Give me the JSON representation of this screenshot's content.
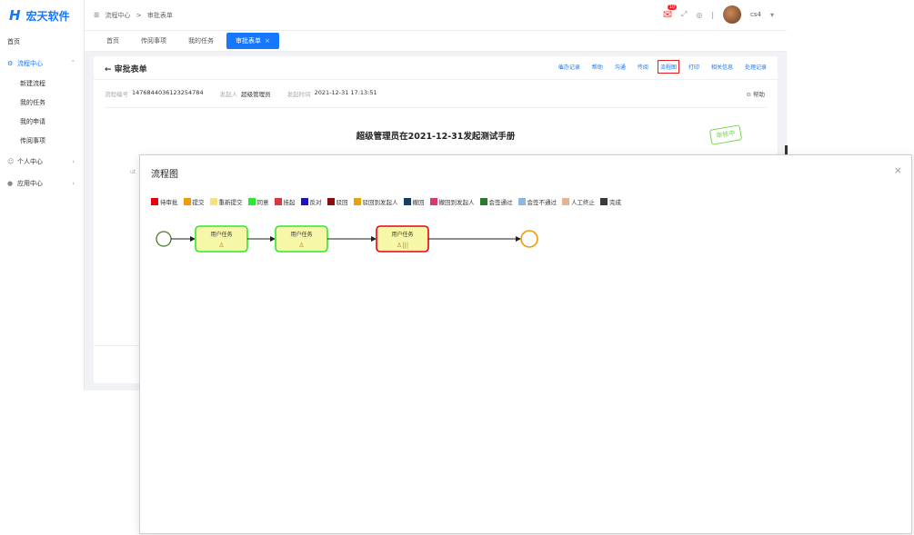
{
  "logo": {
    "text": "宏天软件"
  },
  "sidebar": {
    "items": [
      {
        "label": "首页"
      },
      {
        "label": "流程中心"
      },
      {
        "label": "新建流程"
      },
      {
        "label": "我的任务"
      },
      {
        "label": "我的申请"
      },
      {
        "label": "传阅事项"
      },
      {
        "label": "个人中心"
      },
      {
        "label": "应用中心"
      }
    ]
  },
  "breadcrumb": {
    "root": "流程中心",
    "sep": ">",
    "current": "审批表单"
  },
  "header": {
    "notification_count": "10",
    "username": "cs4"
  },
  "tabs": [
    {
      "label": "首页"
    },
    {
      "label": "传阅事项"
    },
    {
      "label": "我的任务"
    },
    {
      "label": "审批表单",
      "close": "×"
    }
  ],
  "card": {
    "back_label": "← 审批表单",
    "actions": [
      "催办记录",
      "帮助",
      "沟通",
      "传阅",
      "流程图",
      "打印",
      "相关信息",
      "处理记录"
    ],
    "meta": {
      "flow_no_label": "流程编号",
      "flow_no": "1476844036123254784",
      "initiator_label": "发起人",
      "initiator": "超级管理员",
      "time_label": "发起时间",
      "time": "2021-12-31 17:13:51"
    },
    "help_label": "帮助",
    "doc_title": "超级管理员在2021-12-31发起测试手册",
    "stamp": "审核中"
  },
  "modal": {
    "title": "流程图",
    "close": "×",
    "legend": [
      {
        "label": "待审批",
        "color": "#e60012"
      },
      {
        "label": "提交",
        "color": "#f29b05"
      },
      {
        "label": "重新提交",
        "color": "#f7e17a"
      },
      {
        "label": "同意",
        "color": "#2ee82e"
      },
      {
        "label": "挂起",
        "color": "#d8383f"
      },
      {
        "label": "反对",
        "color": "#1f13c8"
      },
      {
        "label": "驳回",
        "color": "#8b0d0d"
      },
      {
        "label": "驳回到发起人",
        "color": "#e8a10f"
      },
      {
        "label": "撤回",
        "color": "#1a3a6b"
      },
      {
        "label": "撤回到发起人",
        "color": "#d9386a"
      },
      {
        "label": "会签通过",
        "color": "#2a7a2a"
      },
      {
        "label": "会签不通过",
        "color": "#88b9e6"
      },
      {
        "label": "人工终止",
        "color": "#e9b18d"
      },
      {
        "label": "完成",
        "color": "#3a3a3a"
      }
    ],
    "nodes": [
      {
        "label": "用户任务",
        "status": "同意"
      },
      {
        "label": "用户任务",
        "status": "同意"
      },
      {
        "label": "用户任务",
        "status": "待审批"
      }
    ]
  }
}
